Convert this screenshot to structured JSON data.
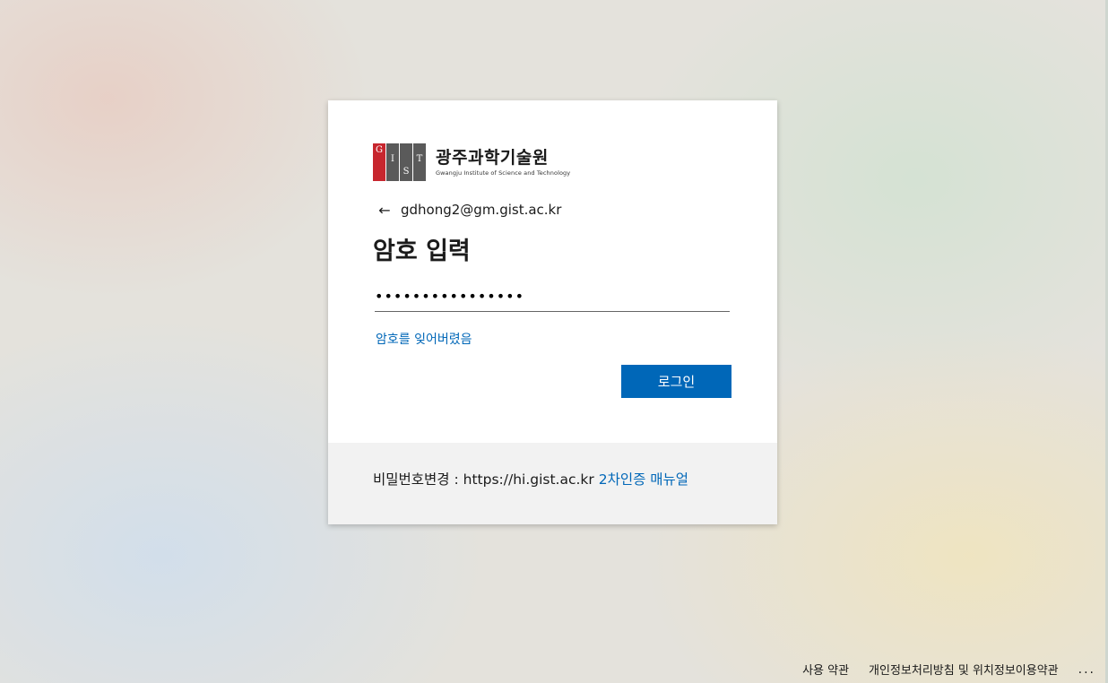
{
  "logo": {
    "letters": [
      "G",
      "I",
      "S",
      "T"
    ],
    "name_kr": "광주과학기술원",
    "name_en": "Gwangju Institute of Science and Technology"
  },
  "identity": {
    "back_icon": "←",
    "email": "gdhong2@gm.gist.ac.kr"
  },
  "title": "암호 입력",
  "password": {
    "value": "••••••••••••••••",
    "placeholder": ""
  },
  "forgot_link": "암호를 잊어버렸음",
  "signin_button": "로그인",
  "footer_panel": {
    "text": "비밀번호변경 : https://hi.gist.ac.kr",
    "link": "2차인증 매뉴얼"
  },
  "page_footer": {
    "terms": "사용 약관",
    "privacy": "개인정보처리방침 및 위치정보이용약관",
    "more": "..."
  },
  "colors": {
    "accent": "#0067b8",
    "logo_red": "#c7262e",
    "logo_gray": "#5a5a5a"
  }
}
